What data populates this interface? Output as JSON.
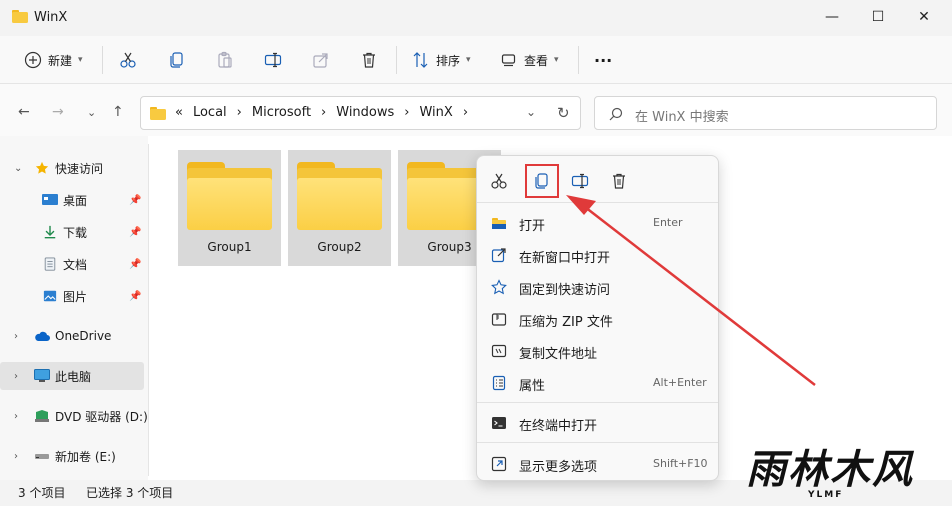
{
  "window": {
    "title": "WinX",
    "minimize": "—",
    "maximize": "☐",
    "close": "✕"
  },
  "toolbar": {
    "new_label": "新建",
    "sort_label": "排序",
    "view_label": "查看",
    "more_label": "···"
  },
  "address": {
    "back": "←",
    "forward": "→",
    "history": "⌄",
    "up": "↑",
    "crumbs": [
      "«",
      "Local",
      "Microsoft",
      "Windows",
      "WinX"
    ],
    "separator": "›",
    "history_caret": "⌄",
    "refresh": "↻",
    "search_placeholder": "在 WinX 中搜索"
  },
  "sidebar": {
    "items": [
      {
        "label": "快速访问",
        "chevron": "⌄",
        "pin": ""
      },
      {
        "label": "桌面",
        "chevron": "",
        "pin": "📌"
      },
      {
        "label": "下载",
        "chevron": "",
        "pin": "📌"
      },
      {
        "label": "文档",
        "chevron": "",
        "pin": "📌"
      },
      {
        "label": "图片",
        "chevron": "",
        "pin": "📌"
      },
      {
        "label": "OneDrive",
        "chevron": "›",
        "pin": ""
      },
      {
        "label": "此电脑",
        "chevron": "›",
        "pin": ""
      },
      {
        "label": "DVD 驱动器 (D:)",
        "chevron": "›",
        "pin": ""
      },
      {
        "label": "新加卷 (E:)",
        "chevron": "›",
        "pin": ""
      }
    ]
  },
  "files": [
    {
      "name": "Group1"
    },
    {
      "name": "Group2"
    },
    {
      "name": "Group3"
    }
  ],
  "status": {
    "count": "3 个项目",
    "selected": "已选择 3 个项目"
  },
  "context_menu": {
    "items": [
      {
        "label": "打开",
        "shortcut": "Enter"
      },
      {
        "label": "在新窗口中打开",
        "shortcut": ""
      },
      {
        "label": "固定到快速访问",
        "shortcut": ""
      },
      {
        "label": "压缩为 ZIP 文件",
        "shortcut": ""
      },
      {
        "label": "复制文件地址",
        "shortcut": ""
      },
      {
        "label": "属性",
        "shortcut": "Alt+Enter"
      },
      {
        "label": "在终端中打开",
        "shortcut": ""
      },
      {
        "label": "显示更多选项",
        "shortcut": "Shift+F10"
      }
    ]
  },
  "watermark": {
    "main": "雨林木风",
    "sub": "YLMF"
  },
  "colors": {
    "folder": "#f4c53a",
    "highlight": "#e03a3a",
    "accent": "#0067c0"
  }
}
